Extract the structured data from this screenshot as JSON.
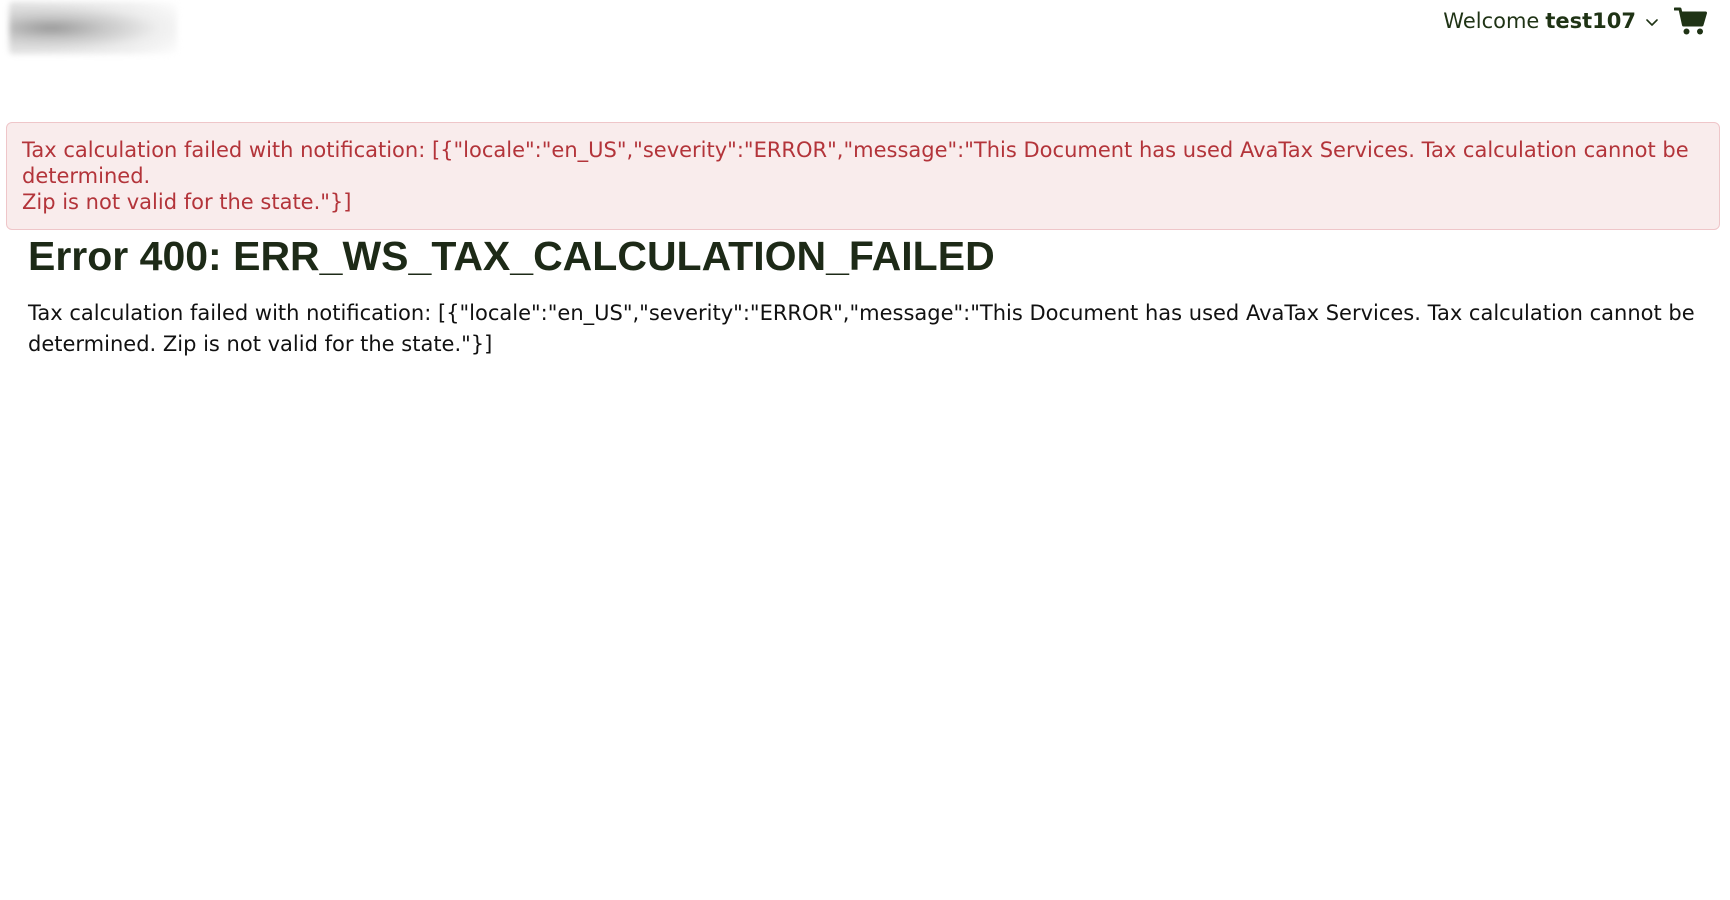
{
  "header": {
    "welcome_label": "Welcome",
    "username": "test107",
    "icons": {
      "dropdown": "chevron-down-icon",
      "cart": "shopping-cart-icon"
    }
  },
  "alert": {
    "message_line1": "Tax calculation failed with notification: [{\"locale\":\"en_US\",\"severity\":\"ERROR\",\"message\":\"This Document has used AvaTax Services. Tax calculation cannot be determined.",
    "message_line2": "Zip is not valid for the state.\"}]",
    "text_color": "#b3343a",
    "background_color": "#f9ecec"
  },
  "error": {
    "title": "Error 400: ERR_WS_TAX_CALCULATION_FAILED",
    "message": "Tax calculation failed with notification: [{\"locale\":\"en_US\",\"severity\":\"ERROR\",\"message\":\"This Document has used AvaTax Services. Tax calculation cannot be determined. Zip is not valid for the state.\"}]"
  },
  "colors": {
    "brand_text": "#1f3315",
    "alert_border": "#efc6c9"
  }
}
